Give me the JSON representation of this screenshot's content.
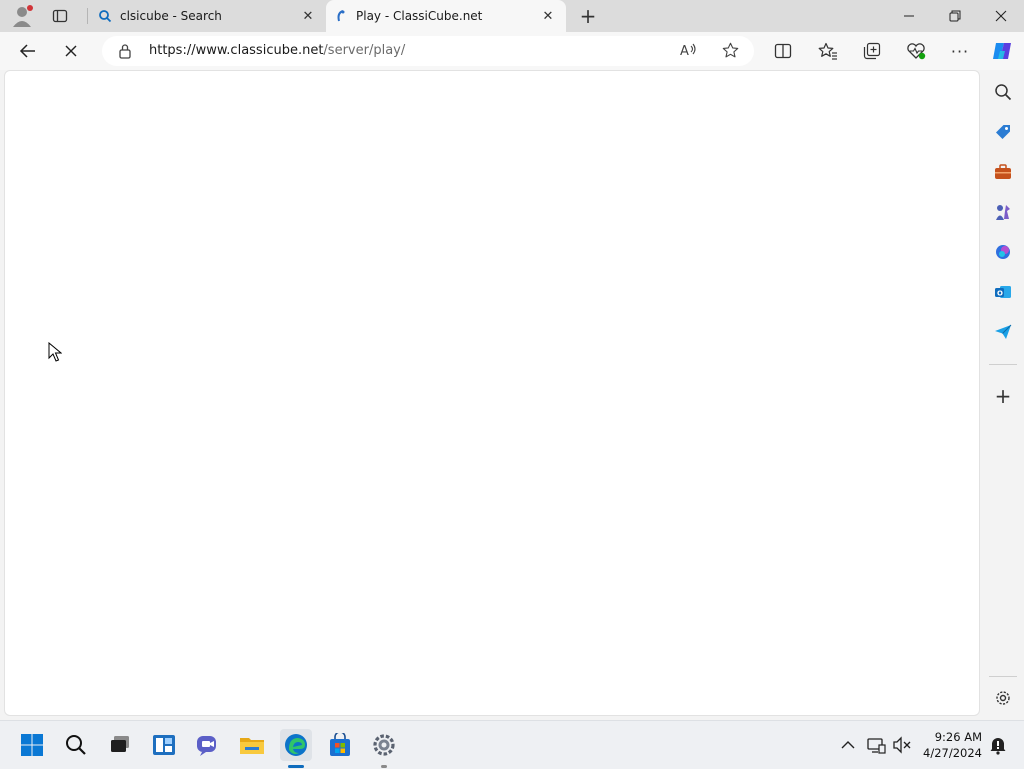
{
  "browser": {
    "tabs": [
      {
        "title": "clsicube - Search",
        "icon": "search-icon",
        "active": false
      },
      {
        "title": "Play - ClassiCube.net",
        "icon": "classicube-favicon-icon",
        "active": true
      }
    ],
    "url_host": "https://www.classicube.net",
    "url_path": "/server/play/",
    "accent": "#0f6cbd"
  },
  "taskbar": {
    "time": "9:26 AM",
    "date": "4/27/2024"
  }
}
